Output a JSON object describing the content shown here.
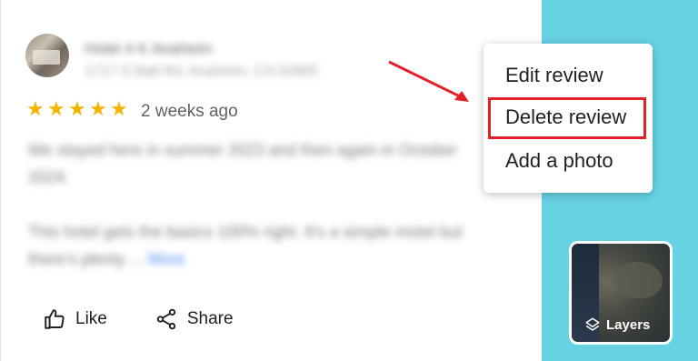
{
  "reviewer": {
    "name": "Hotel 4 K Anaheim",
    "subtitle": "1717 S Ball Rd, Anaheim, CA 92805"
  },
  "review": {
    "rating": 5,
    "stars": [
      "★",
      "★",
      "★",
      "★",
      "★"
    ],
    "time": "2 weeks ago",
    "paragraph_1": "We stayed here in summer 2023 and then again in October 2024.",
    "paragraph_2": "This hotel gets the basics 100% right. It's a simple motel but there's plenty ...",
    "more_label": "More"
  },
  "actions": {
    "like_label": "Like",
    "share_label": "Share"
  },
  "menu": {
    "items": [
      "Edit review",
      "Delete review",
      "Add a photo"
    ],
    "highlighted": "Delete review"
  },
  "map": {
    "layers_label": "Layers"
  },
  "colors": {
    "map_water": "#67d2e4",
    "star": "#f5b400",
    "highlight": "#e3202a",
    "link": "#4a8af4"
  }
}
